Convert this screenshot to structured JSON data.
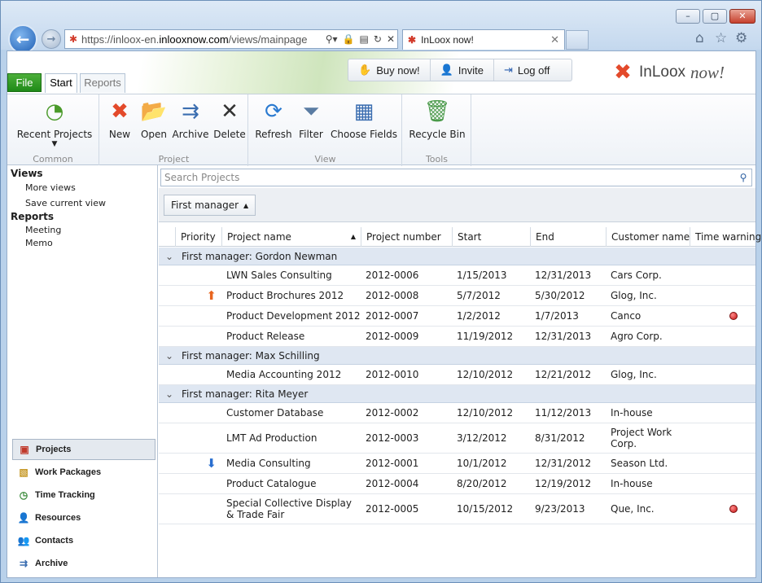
{
  "browser": {
    "url_prefix": "https://inloox-en.",
    "url_domain": "inlooxnow.com",
    "url_path": "/views/mainpage",
    "tab_title": "InLoox now!",
    "minimize": "–",
    "maximize": "▢",
    "close": "✕"
  },
  "app": {
    "file_tab": "File",
    "tabs": [
      "Start",
      "Reports"
    ],
    "top_buttons": [
      "Buy now!",
      "Invite",
      "Log off"
    ],
    "logo_name": "InLoox",
    "logo_suffix": "now!"
  },
  "ribbon": {
    "common": {
      "label": "Common",
      "recent": "Recent Projects"
    },
    "project": {
      "label": "Project",
      "new": "New",
      "open": "Open",
      "archive": "Archive",
      "delete": "Delete"
    },
    "view": {
      "label": "View",
      "refresh": "Refresh",
      "filter": "Filter",
      "choose": "Choose Fields"
    },
    "tools": {
      "label": "Tools",
      "recycle": "Recycle Bin"
    }
  },
  "sidebar": {
    "views_header": "Views",
    "views": [
      "More views",
      "Save current view"
    ],
    "reports_header": "Reports",
    "reports": [
      "Meeting",
      "Memo"
    ],
    "nav": [
      "Projects",
      "Work Packages",
      "Time Tracking",
      "Resources",
      "Contacts",
      "Archive"
    ]
  },
  "main": {
    "search_placeholder": "Search Projects",
    "group_chip": "First manager",
    "columns": [
      "Priority",
      "Project name",
      "Project number",
      "Start",
      "End",
      "Customer name",
      "Time warning"
    ],
    "groups": [
      {
        "title": "First manager: Gordon Newman"
      },
      {
        "title": "First manager: Max Schilling"
      },
      {
        "title": "First manager: Rita Meyer"
      }
    ],
    "rows": [
      {
        "name": "LWN Sales Consulting",
        "number": "2012-0006",
        "start": "1/15/2013",
        "end": "12/31/2013",
        "customer": "Cars Corp."
      },
      {
        "name": "Product Brochures 2012",
        "number": "2012-0008",
        "start": "5/7/2012",
        "end": "5/30/2012",
        "customer": "Glog, Inc."
      },
      {
        "name": "Product Development 2012",
        "number": "2012-0007",
        "start": "1/2/2012",
        "end": "1/7/2013",
        "customer": "Canco"
      },
      {
        "name": "Product Release",
        "number": "2012-0009",
        "start": "11/19/2012",
        "end": "12/31/2013",
        "customer": "Agro Corp."
      },
      {
        "name": "Media Accounting 2012",
        "number": "2012-0010",
        "start": "12/10/2012",
        "end": "12/21/2012",
        "customer": "Glog, Inc."
      },
      {
        "name": "Customer Database",
        "number": "2012-0002",
        "start": "12/10/2012",
        "end": "11/12/2013",
        "customer": "In-house"
      },
      {
        "name": "LMT Ad Production",
        "number": "2012-0003",
        "start": "3/12/2012",
        "end": "8/31/2012",
        "customer": "Project Work Corp."
      },
      {
        "name": "Media Consulting",
        "number": "2012-0001",
        "start": "10/1/2012",
        "end": "12/31/2012",
        "customer": "Season Ltd."
      },
      {
        "name": "Product Catalogue",
        "number": "2012-0004",
        "start": "8/20/2012",
        "end": "12/19/2012",
        "customer": "In-house"
      },
      {
        "name": "Special Collective Display & Trade Fair",
        "number": "2012-0005",
        "start": "10/15/2012",
        "end": "9/23/2013",
        "customer": "Que, Inc."
      }
    ],
    "priority_icons": {
      "1": "arrow-up-orange",
      "7": "arrow-down-blue"
    },
    "time_warning_rows": [
      2,
      9
    ],
    "colors": {
      "group_bg": "#dfe7f2",
      "warning": "#c21212",
      "file_tab": "#1f8a18"
    }
  }
}
